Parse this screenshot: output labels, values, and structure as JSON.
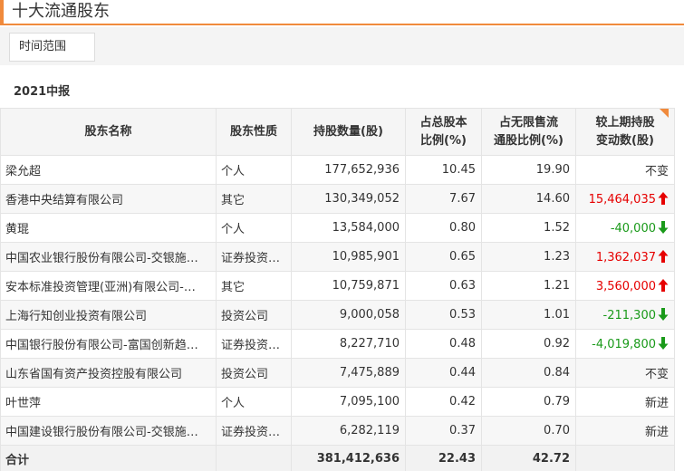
{
  "page": {
    "title": "十大流通股东"
  },
  "filter": {
    "button_label": "时间范围"
  },
  "period": "2021中报",
  "table": {
    "headers": [
      {
        "line1": "股东名称",
        "line2": ""
      },
      {
        "line1": "股东性质",
        "line2": ""
      },
      {
        "line1": "持股数量(股)",
        "line2": ""
      },
      {
        "line1": "占总股本",
        "line2": "比例(%)"
      },
      {
        "line1": "占无限售流",
        "line2": "通股比例(%)"
      },
      {
        "line1": "较上期持股",
        "line2": "变动数(股)"
      }
    ],
    "rows": [
      {
        "name": "梁允超",
        "type": "个人",
        "shares": "177,652,936",
        "total_pct": "10.45",
        "float_pct": "19.90",
        "change": "不变",
        "dir": "none"
      },
      {
        "name": "香港中央结算有限公司",
        "type": "其它",
        "shares": "130,349,052",
        "total_pct": "7.67",
        "float_pct": "14.60",
        "change": "15,464,035",
        "dir": "up"
      },
      {
        "name": "黄琨",
        "type": "个人",
        "shares": "13,584,000",
        "total_pct": "0.80",
        "float_pct": "1.52",
        "change": "-40,000",
        "dir": "down"
      },
      {
        "name": "中国农业银行股份有限公司-交银施…",
        "type": "证券投资…",
        "shares": "10,985,901",
        "total_pct": "0.65",
        "float_pct": "1.23",
        "change": "1,362,037",
        "dir": "up"
      },
      {
        "name": "安本标准投资管理(亚洲)有限公司-…",
        "type": "其它",
        "shares": "10,759,871",
        "total_pct": "0.63",
        "float_pct": "1.21",
        "change": "3,560,000",
        "dir": "up"
      },
      {
        "name": "上海行知创业投资有限公司",
        "type": "投资公司",
        "shares": "9,000,058",
        "total_pct": "0.53",
        "float_pct": "1.01",
        "change": "-211,300",
        "dir": "down"
      },
      {
        "name": "中国银行股份有限公司-富国创新趋…",
        "type": "证券投资…",
        "shares": "8,227,710",
        "total_pct": "0.48",
        "float_pct": "0.92",
        "change": "-4,019,800",
        "dir": "down"
      },
      {
        "name": "山东省国有资产投资控股有限公司",
        "type": "投资公司",
        "shares": "7,475,889",
        "total_pct": "0.44",
        "float_pct": "0.84",
        "change": "不变",
        "dir": "none"
      },
      {
        "name": "叶世萍",
        "type": "个人",
        "shares": "7,095,100",
        "total_pct": "0.42",
        "float_pct": "0.79",
        "change": "新进",
        "dir": "none"
      },
      {
        "name": "中国建设银行股份有限公司-交银施…",
        "type": "证券投资…",
        "shares": "6,282,119",
        "total_pct": "0.37",
        "float_pct": "0.70",
        "change": "新进",
        "dir": "none"
      }
    ],
    "total": {
      "label": "合计",
      "shares": "381,412,636",
      "total_pct": "22.43",
      "float_pct": "42.72"
    }
  },
  "colors": {
    "accent": "#f08a3c",
    "increase": "#e60000",
    "decrease": "#1a9a1a"
  }
}
